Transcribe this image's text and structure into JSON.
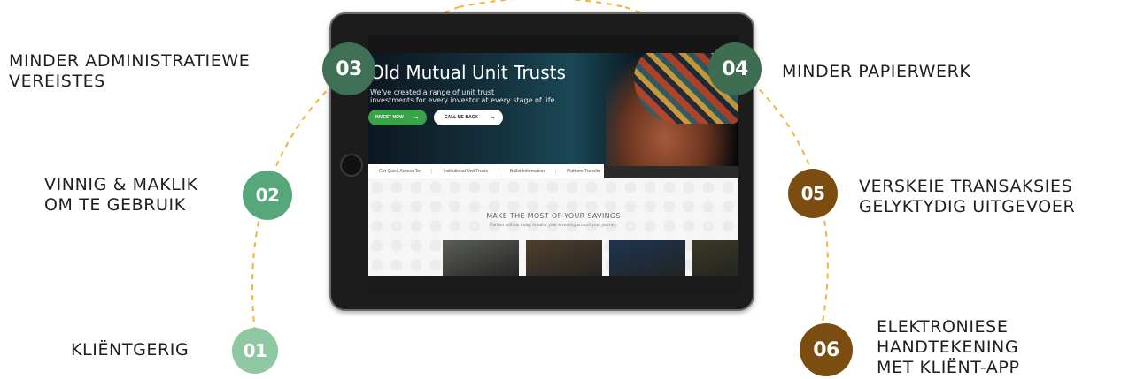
{
  "steps": [
    {
      "number": "01",
      "lines": [
        "KLIËNTGERIG"
      ],
      "color": "#8fc7a2"
    },
    {
      "number": "02",
      "lines": [
        "VINNIG & MAKLIK",
        "OM TE GEBRUIK"
      ],
      "color": "#56a87a"
    },
    {
      "number": "03",
      "lines": [
        "MINDER ADMINISTRATIEWE",
        "VEREISTES"
      ],
      "color": "#3f6f55"
    },
    {
      "number": "04",
      "lines": [
        "MINDER PAPIERWERK"
      ],
      "color": "#3d6e52"
    },
    {
      "number": "05",
      "lines": [
        "VERSKEIE TRANSAKSIES",
        "GELYKTYDIG UITGEVOER"
      ],
      "color": "#7c4d10"
    },
    {
      "number": "06",
      "lines": [
        "ELEKTRONIESE",
        "HANDTEKENING",
        "MET KLIËNT-APP"
      ],
      "color": "#7c4d10"
    }
  ],
  "arc_color": "#f0b43c",
  "tablet": {
    "hero_title_light": "Old Mutual",
    "hero_title_bold": "Unit Trusts",
    "hero_sub_line1": "We've created a range of unit trust",
    "hero_sub_line2": "investments for every investor at every stage of life.",
    "invest_button": "INVEST NOW",
    "call_button": "CALL ME BACK",
    "quick_access": [
      "Get Quick Access To:",
      "Institutional Unit Trusts",
      "Ballot Information",
      "Platform Transfer"
    ],
    "savings_title": "MAKE THE MOST OF YOUR SAVINGS",
    "savings_sub": "Partner with us today to tailor your investing around your journey.",
    "thumb_colors": [
      "#5b5e58",
      "#4e3f2c",
      "#1d3550",
      "#3a3a26"
    ]
  }
}
